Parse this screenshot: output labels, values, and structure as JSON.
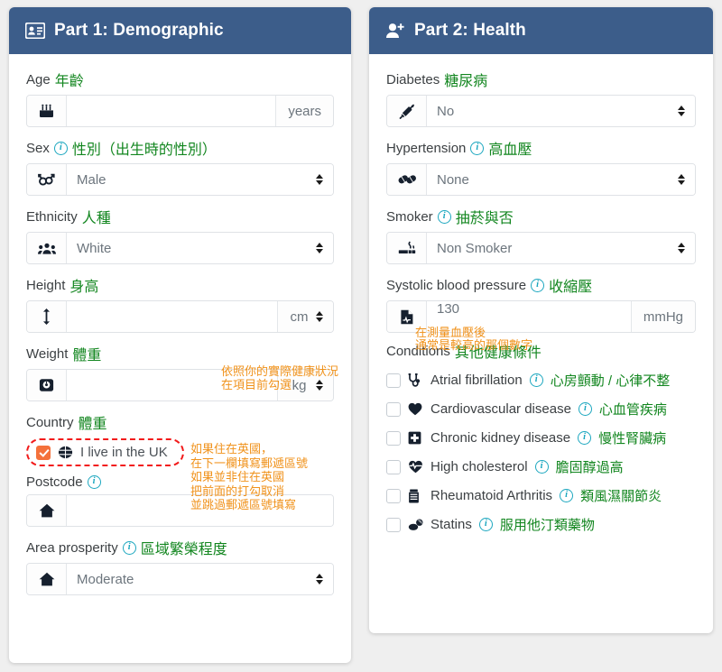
{
  "left_card": {
    "header": {
      "icon": "id-card-icon",
      "title": "Part 1: Demographic"
    },
    "fields": [
      {
        "key": "age",
        "label": "Age",
        "zh": "年齡",
        "icon": "cake-icon",
        "type": "text",
        "value": "",
        "suffix": "years"
      },
      {
        "key": "sex",
        "label": "Sex",
        "zh": "性別（出生時的性別）",
        "info": true,
        "icon": "gender-icon",
        "type": "select",
        "value": "Male"
      },
      {
        "key": "ethnicity",
        "label": "Ethnicity",
        "zh": "人種",
        "icon": "people-icon",
        "type": "select",
        "value": "White"
      },
      {
        "key": "height",
        "label": "Height",
        "zh": "身高",
        "icon": "arrows-vertical-icon",
        "type": "text",
        "value": "",
        "suffix": "cm",
        "suffix_select": true
      },
      {
        "key": "weight",
        "label": "Weight",
        "zh": "體重",
        "icon": "weight-scale-icon",
        "type": "text",
        "value": "",
        "suffix": "kg",
        "suffix_select": true
      },
      {
        "key": "country",
        "label": "Country",
        "zh": "體重",
        "type": "checkbox",
        "checkbox_label": "I live in the UK",
        "checked": true,
        "icon": "globe-icon"
      },
      {
        "key": "postcode",
        "label": "Postcode",
        "zh": "",
        "info": true,
        "icon": "home-icon",
        "type": "text",
        "value": ""
      },
      {
        "key": "area_prosperity",
        "label": "Area prosperity",
        "zh": "區域繁榮程度",
        "info": true,
        "icon": "home-icon",
        "type": "select",
        "value": "Moderate"
      }
    ],
    "annotation_country": "如果住在英國，\n在下一欄填寫郵遞區號\n如果並非住在英國\n把前面的打勾取消\n並跳過郵遞區號填寫"
  },
  "right_card": {
    "header": {
      "icon": "user-plus-icon",
      "title": "Part 2: Health"
    },
    "fields": [
      {
        "key": "diabetes",
        "label": "Diabetes",
        "zh": "糖尿病",
        "icon": "syringe-icon",
        "type": "select",
        "value": "No"
      },
      {
        "key": "hypertension",
        "label": "Hypertension",
        "zh": "高血壓",
        "info": true,
        "icon": "pills-icon",
        "type": "select",
        "value": "None"
      },
      {
        "key": "smoker",
        "label": "Smoker",
        "zh": "抽菸與否",
        "info": true,
        "icon": "cigarette-icon",
        "type": "select",
        "value": "Non Smoker"
      },
      {
        "key": "systolic_blood_pressure",
        "label": "Systolic blood pressure",
        "zh": "收縮壓",
        "info": true,
        "icon": "bp-document-icon",
        "type": "text",
        "value": "130",
        "suffix": "mmHg"
      }
    ],
    "conditions_label": "Conditions",
    "conditions_zh": "其他健康條件",
    "annotation_sbp": "在測量血壓後\n通常是較高的那個數字",
    "annotation_conditions": "依照你的實際健康狀況\n在項目前勾選",
    "conditions": [
      {
        "key": "atrial_fibrillation",
        "icon": "stethoscope-icon",
        "label": "Atrial fibrillation",
        "zh": "心房顫動 / 心律不整",
        "checked": false
      },
      {
        "key": "cardiovascular_disease",
        "icon": "heart-icon",
        "label": "Cardiovascular disease",
        "zh": "心血管疾病",
        "checked": false
      },
      {
        "key": "chronic_kidney_disease",
        "icon": "medical-cross-icon",
        "label": "Chronic kidney disease",
        "zh": "慢性腎臟病",
        "checked": false
      },
      {
        "key": "high_cholesterol",
        "icon": "heartbeat-icon",
        "label": "High cholesterol",
        "zh": "膽固醇過高",
        "checked": false
      },
      {
        "key": "rheumatoid_arthritis",
        "icon": "pill-bottle-icon",
        "label": "Rheumatoid Arthritis",
        "zh": "類風濕關節炎",
        "checked": false
      },
      {
        "key": "statins",
        "icon": "tablets-icon",
        "label": "Statins",
        "zh": "服用他汀類藥物",
        "checked": false
      }
    ]
  },
  "colors": {
    "header_bg": "#3c5d8a",
    "zh_green": "#12861f",
    "annotation_orange": "#f0921b",
    "highlight_red": "#f21b1b",
    "checkbox_orange": "#f4713b",
    "info_cyan": "#1ca7bf",
    "page_bg": "#efefef"
  }
}
